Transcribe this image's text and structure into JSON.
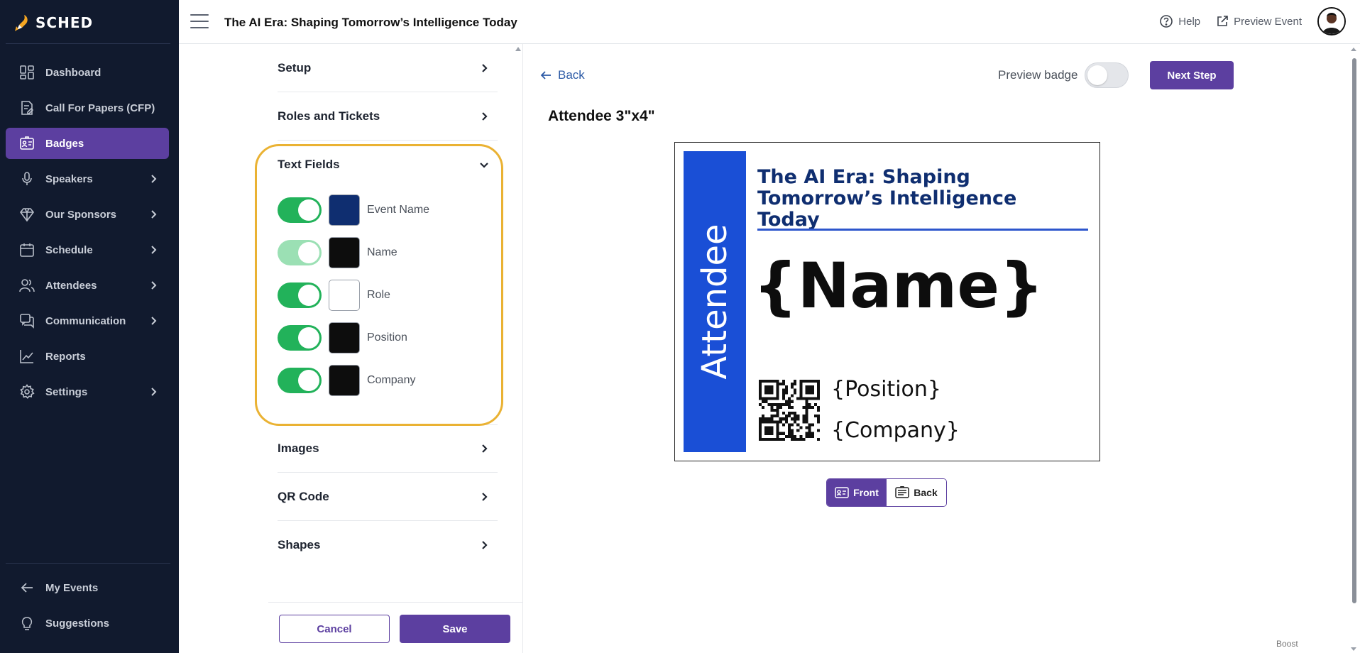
{
  "app": {
    "logo_text": "SCHED"
  },
  "sidebar": {
    "items": [
      {
        "label": "Dashboard",
        "icon": "dashboard-icon",
        "has_children": false,
        "active": false
      },
      {
        "label": "Call For Papers (CFP)",
        "icon": "document-edit-icon",
        "has_children": false,
        "active": false
      },
      {
        "label": "Badges",
        "icon": "badge-icon",
        "has_children": false,
        "active": true
      },
      {
        "label": "Speakers",
        "icon": "microphone-icon",
        "has_children": true,
        "active": false
      },
      {
        "label": "Our Sponsors",
        "icon": "diamond-icon",
        "has_children": true,
        "active": false
      },
      {
        "label": "Schedule",
        "icon": "calendar-icon",
        "has_children": true,
        "active": false
      },
      {
        "label": "Attendees",
        "icon": "people-icon",
        "has_children": true,
        "active": false
      },
      {
        "label": "Communication",
        "icon": "chat-icon",
        "has_children": true,
        "active": false
      },
      {
        "label": "Reports",
        "icon": "chart-line-icon",
        "has_children": false,
        "active": false
      },
      {
        "label": "Settings",
        "icon": "gear-icon",
        "has_children": true,
        "active": false
      }
    ],
    "bottom_items": [
      {
        "label": "My Events",
        "icon": "arrow-left-icon"
      },
      {
        "label": "Suggestions",
        "icon": "lightbulb-icon"
      }
    ]
  },
  "header": {
    "title": "The AI Era: Shaping Tomorrow’s Intelligence Today",
    "help_label": "Help",
    "preview_event_label": "Preview Event"
  },
  "panel": {
    "sections": {
      "setup": "Setup",
      "roles_tickets": "Roles and Tickets",
      "text_fields": "Text Fields",
      "images": "Images",
      "qr_code": "QR Code",
      "shapes": "Shapes"
    },
    "text_fields": [
      {
        "label": "Event Name",
        "enabled": true,
        "color": "#0f2e70",
        "locked": false
      },
      {
        "label": "Name",
        "enabled": true,
        "color": "#0d0d0d",
        "locked": true
      },
      {
        "label": "Role",
        "enabled": true,
        "color": "#ffffff",
        "locked": false
      },
      {
        "label": "Position",
        "enabled": true,
        "color": "#0d0d0d",
        "locked": false
      },
      {
        "label": "Company",
        "enabled": true,
        "color": "#0d0d0d",
        "locked": false
      }
    ],
    "cancel_label": "Cancel",
    "save_label": "Save"
  },
  "preview": {
    "back_label": "Back",
    "preview_badge_label": "Preview badge",
    "preview_badge_on": false,
    "next_step_label": "Next Step",
    "badge_title": "Attendee 3\"x4\"",
    "badge": {
      "role_text": "Attendee",
      "event_name": "The AI Era: Shaping Tomorrow’s Intelligence Today",
      "name": "{Name}",
      "position": "{Position}",
      "company": "{Company}",
      "strip_color": "#1a4fd6",
      "event_color": "#0f2e70"
    },
    "front_label": "Front",
    "back_face_label": "Back"
  },
  "footer": {
    "boost_label": "Boost"
  },
  "colors": {
    "accent": "#5c3fa0",
    "sidebar_bg": "#111a2e",
    "toggle_on": "#22b25a",
    "highlight": "#eab233"
  }
}
